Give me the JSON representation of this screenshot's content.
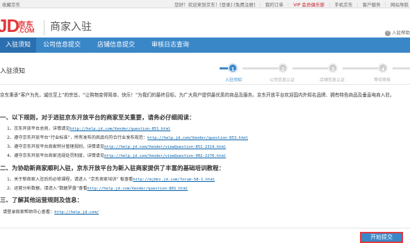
{
  "topbar": {
    "favorite": "收藏京东",
    "welcome": "您好！欢迎来到京东！[登录] [免费注册]",
    "links": [
      "我的订单",
      "VIP 会员俱乐部",
      "手机京东",
      "客户服务",
      "网站导航"
    ]
  },
  "header": {
    "logo_big": "JD",
    "logo_cn": "京东",
    "logo_com": ".COM",
    "title": "商家入驻",
    "help": "入驻帮助"
  },
  "nav": {
    "tabs": [
      "入驻须知",
      "公司信息提交",
      "店铺信息提交",
      "审核日志查询"
    ]
  },
  "section": {
    "title": "入驻须知",
    "steps": [
      {
        "num": "1",
        "label": "入驻须知"
      },
      {
        "num": "2",
        "label": "公司信息认证"
      },
      {
        "num": "3",
        "label": "店铺信息认证"
      },
      {
        "num": "4",
        "label": "等待审核"
      }
    ]
  },
  "intro": "京东秉承“客户为先，诚信至上”的宗旨，“让购物变得简单、快乐！”为我们的最终目标，为广大用户提供最优质的商品及服务。京东开放平台欢迎国内外知名品牌、拥有特色商品及垂直电商入驻。",
  "sections": [
    {
      "heading": "一、以下规则，对于进驻京东开放平台的商家至关重要，请务必仔细阅读：",
      "items": [
        {
          "text": "1、京东开放平台总则，详情请见",
          "link": "http://help.jd.com/Vender/question-851.html"
        },
        {
          "text": "2、遵守京东开放平台“行业标准”，所有发布的商品均符合行业发布规范：",
          "link": "http://help.jd.com/Vender/question-853.html"
        },
        {
          "text": "3、遵守京东开放平台商家积分管理规则，详情请见",
          "link": "http://help.jd.com/Vender/viewQuestion-851-2314.html"
        },
        {
          "text": "4、遵守京东开放平台商家违规处罚制度，详情请见",
          "link": "http://help.jd.com/Vender/viewQuestion-902-2270.html"
        }
      ]
    },
    {
      "heading": "二、为协助新商家顺利入驻，京东开放平台为新入驻商家提供了丰富的基础培训教程：",
      "items": [
        {
          "text": "1、关于新商家入驻后的必修课程，请进入 “京东卖家培训” 板查看",
          "link": "http://mjbbs.jd.com/forum-58-1.html"
        },
        {
          "text": "2、运营分析数据，请进入“数据罗盘”查看",
          "link": "http://help.jd.com/Vender/question-801.html"
        }
      ]
    },
    {
      "heading": "三、了解其他运营规则及信息：",
      "items": [
        {
          "text": "请登录商家帮助中心查看：",
          "link": "http://help.jd.com/"
        }
      ]
    }
  ],
  "actions": {
    "start": "开始提交"
  },
  "colors": {
    "brand_red": "#e4393c",
    "nav_blue": "#3a87c8",
    "link_blue": "#005ea7"
  }
}
